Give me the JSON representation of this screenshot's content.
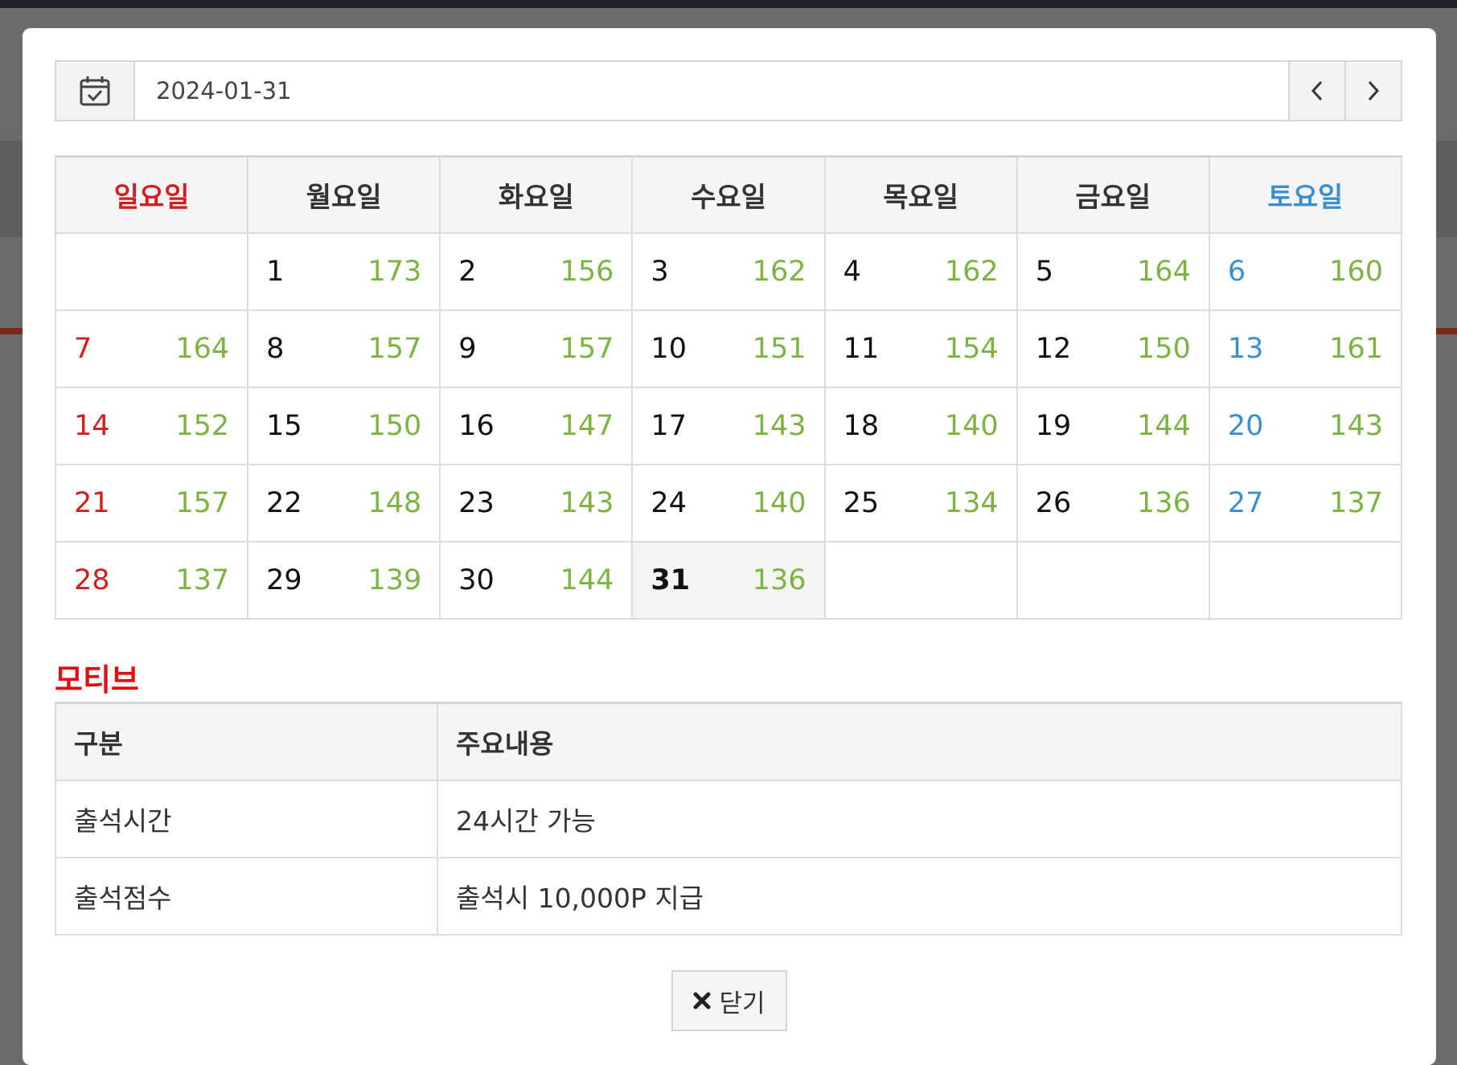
{
  "date_bar": {
    "value": "2024-01-31",
    "calendar_icon": "calendar-check-icon",
    "prev_icon": "chevron-left-icon",
    "next_icon": "chevron-right-icon"
  },
  "calendar": {
    "weekdays": [
      "일요일",
      "월요일",
      "화요일",
      "수요일",
      "목요일",
      "금요일",
      "토요일"
    ],
    "weeks": [
      [
        null,
        {
          "day": "1",
          "count": "173"
        },
        {
          "day": "2",
          "count": "156"
        },
        {
          "day": "3",
          "count": "162"
        },
        {
          "day": "4",
          "count": "162"
        },
        {
          "day": "5",
          "count": "164"
        },
        {
          "day": "6",
          "count": "160"
        }
      ],
      [
        {
          "day": "7",
          "count": "164"
        },
        {
          "day": "8",
          "count": "157"
        },
        {
          "day": "9",
          "count": "157"
        },
        {
          "day": "10",
          "count": "151"
        },
        {
          "day": "11",
          "count": "154"
        },
        {
          "day": "12",
          "count": "150"
        },
        {
          "day": "13",
          "count": "161"
        }
      ],
      [
        {
          "day": "14",
          "count": "152"
        },
        {
          "day": "15",
          "count": "150"
        },
        {
          "day": "16",
          "count": "147"
        },
        {
          "day": "17",
          "count": "143"
        },
        {
          "day": "18",
          "count": "140"
        },
        {
          "day": "19",
          "count": "144"
        },
        {
          "day": "20",
          "count": "143"
        }
      ],
      [
        {
          "day": "21",
          "count": "157"
        },
        {
          "day": "22",
          "count": "148"
        },
        {
          "day": "23",
          "count": "143"
        },
        {
          "day": "24",
          "count": "140"
        },
        {
          "day": "25",
          "count": "134"
        },
        {
          "day": "26",
          "count": "136"
        },
        {
          "day": "27",
          "count": "137"
        }
      ],
      [
        {
          "day": "28",
          "count": "137"
        },
        {
          "day": "29",
          "count": "139"
        },
        {
          "day": "30",
          "count": "144"
        },
        {
          "day": "31",
          "count": "136",
          "today": true
        },
        null,
        null,
        null
      ]
    ],
    "colors": {
      "sunday": "#d11f1f",
      "saturday": "#3a8fd0",
      "count": "#7cb342"
    }
  },
  "section": {
    "title": "모티브",
    "title_color": "#e01010"
  },
  "info_table": {
    "headers": [
      "구분",
      "주요내용"
    ],
    "rows": [
      [
        "출석시간",
        "24시간 가능"
      ],
      [
        "출석점수",
        "출석시 10,000P 지급"
      ]
    ]
  },
  "close_button": {
    "label": "닫기",
    "icon": "close-icon"
  }
}
